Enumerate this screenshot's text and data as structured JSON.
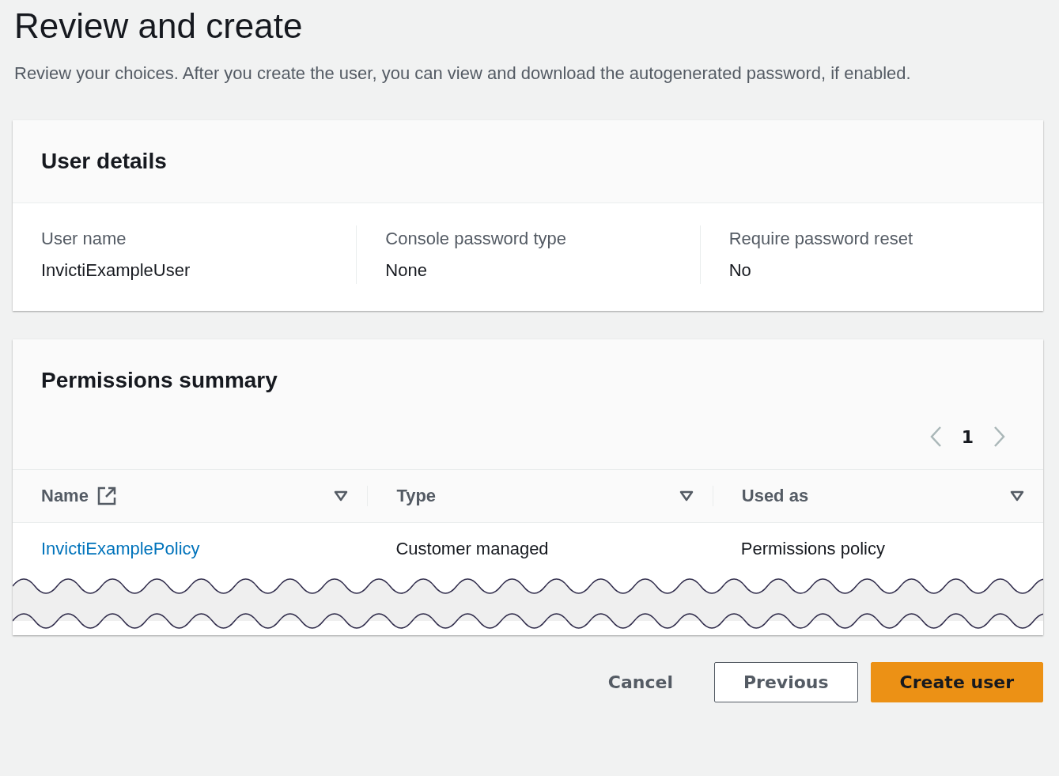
{
  "page": {
    "title": "Review and create",
    "description": "Review your choices. After you create the user, you can view and download the autogenerated password, if enabled."
  },
  "user_details": {
    "title": "User details",
    "fields": [
      {
        "label": "User name",
        "value": "InvictiExampleUser"
      },
      {
        "label": "Console password type",
        "value": "None"
      },
      {
        "label": "Require password reset",
        "value": "No"
      }
    ]
  },
  "permissions_summary": {
    "title": "Permissions summary",
    "pagination": {
      "page": "1"
    },
    "table": {
      "columns": [
        {
          "label": "Name",
          "kind": "link"
        },
        {
          "label": "Type",
          "kind": "plain"
        },
        {
          "label": "Used as",
          "kind": "plain"
        }
      ],
      "rows": [
        [
          "InvictiExamplePolicy",
          "Customer managed",
          "Permissions policy"
        ]
      ]
    }
  },
  "buttons": [
    {
      "label": "Cancel",
      "kind": "link"
    },
    {
      "label": "Previous",
      "kind": "normal"
    },
    {
      "label": "Create user",
      "kind": "primary"
    }
  ]
}
